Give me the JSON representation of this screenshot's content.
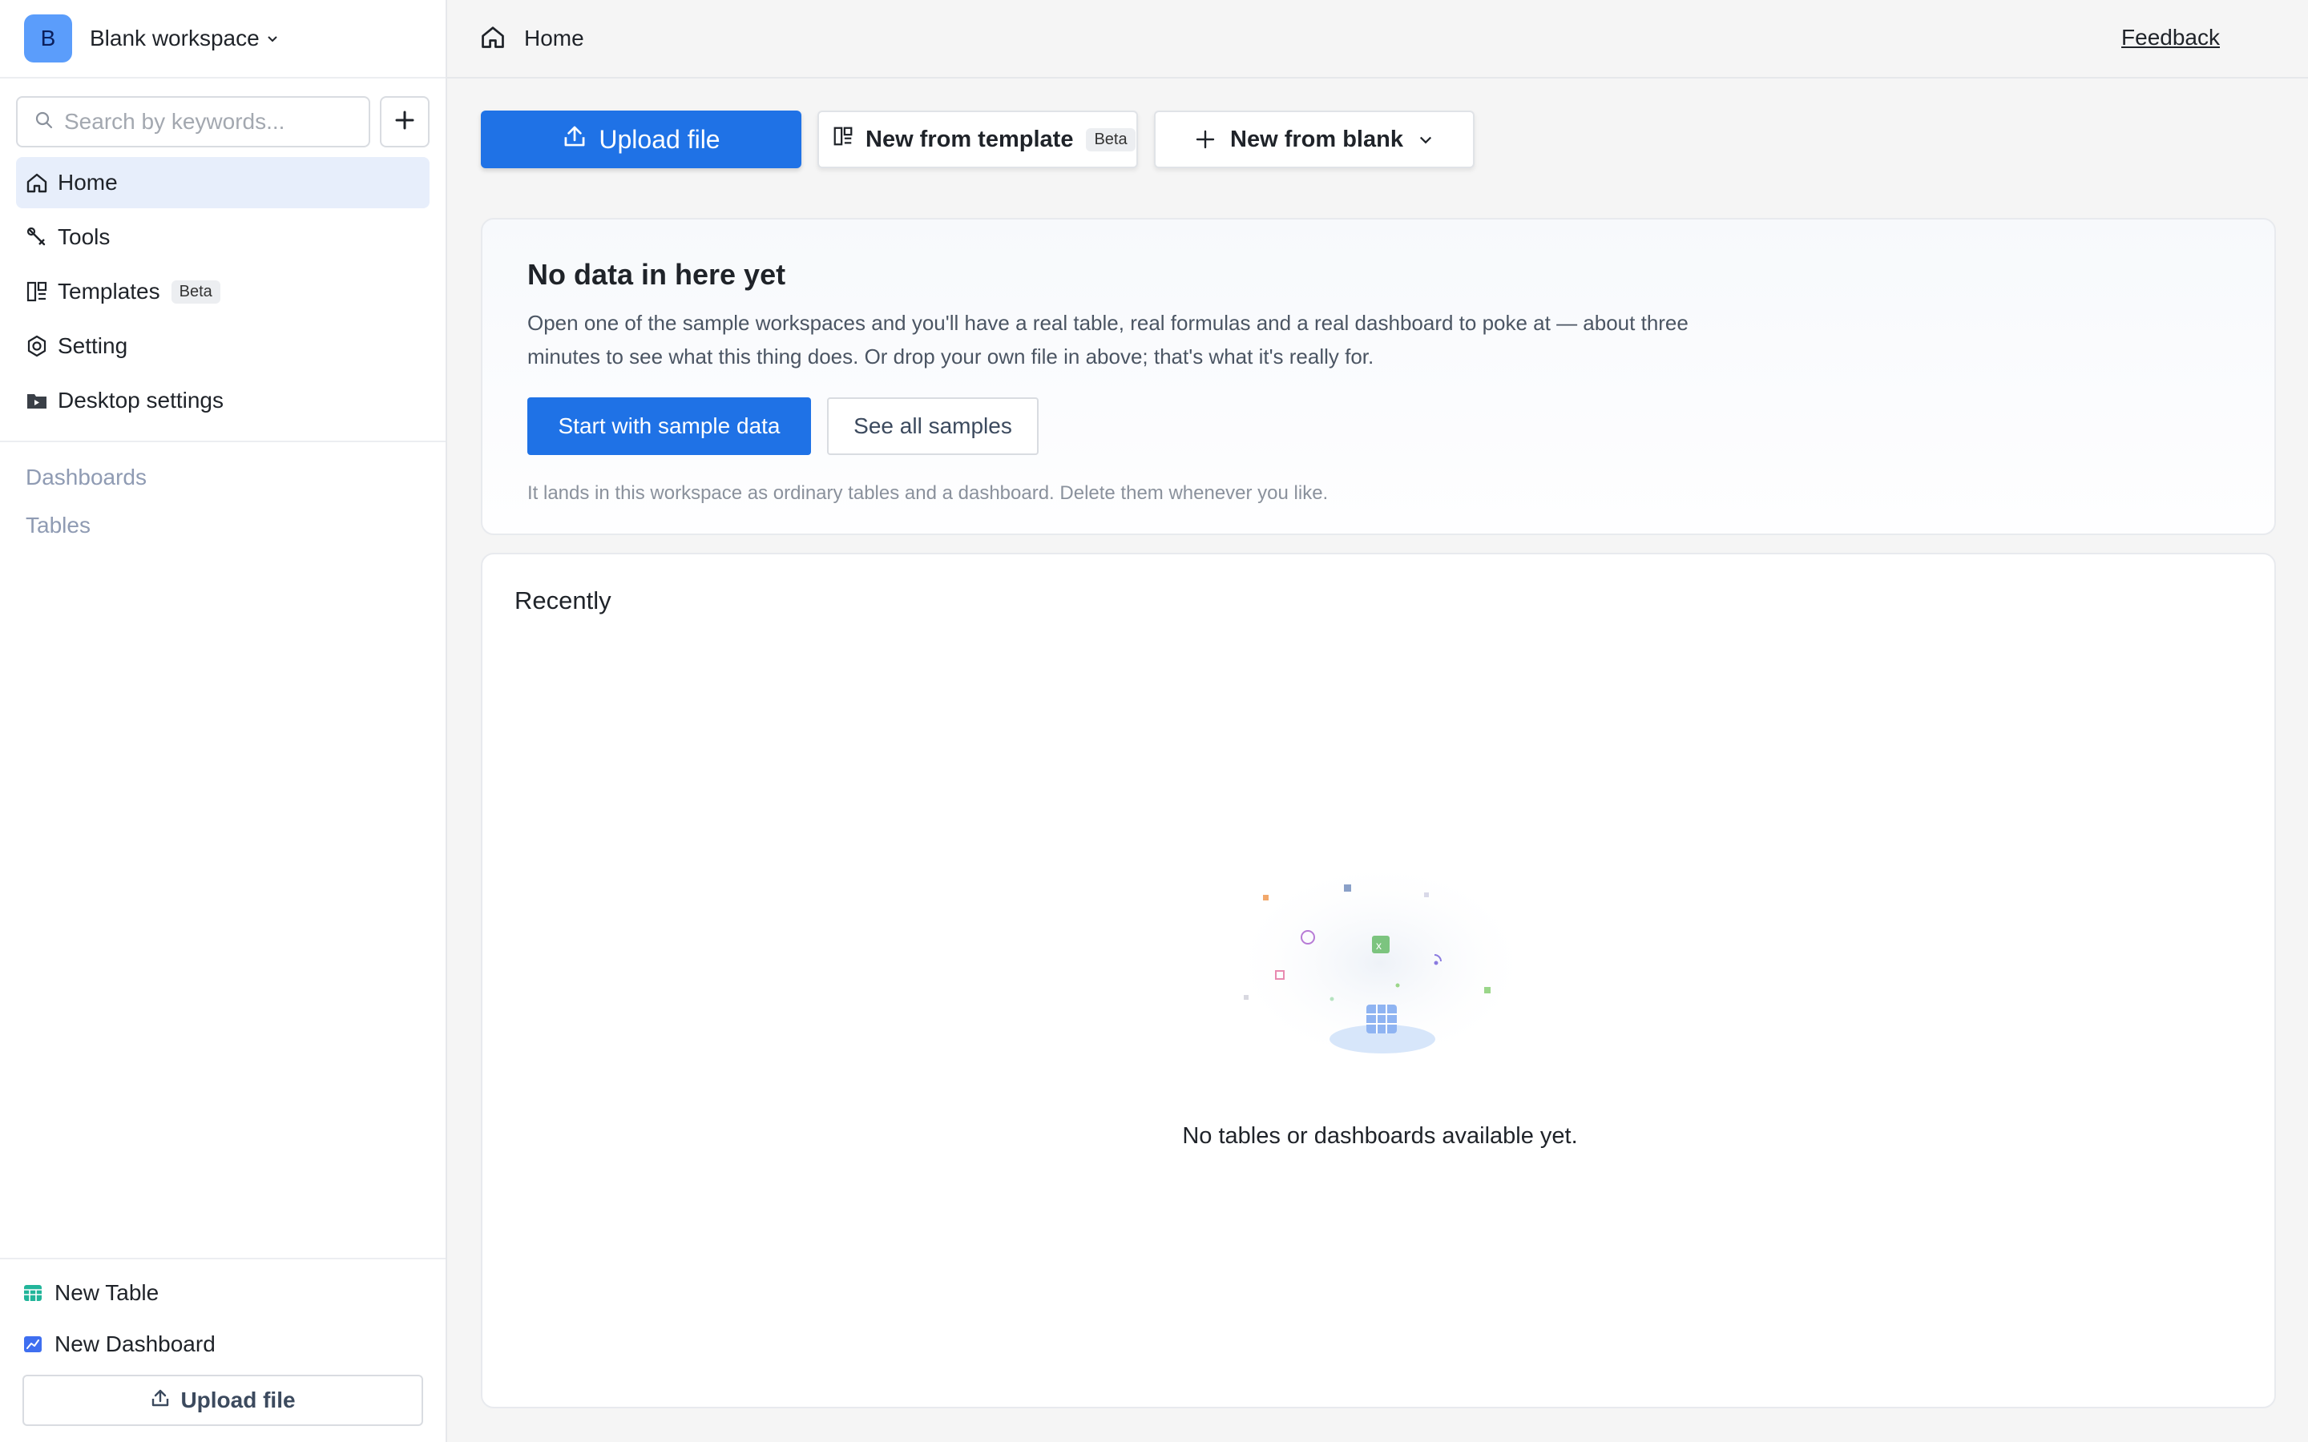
{
  "workspace": {
    "avatar_letter": "B",
    "name": "Blank workspace"
  },
  "search": {
    "placeholder": "Search by keywords..."
  },
  "sidebar": {
    "items": [
      {
        "label": "Home",
        "icon": "home-icon",
        "active": true
      },
      {
        "label": "Tools",
        "icon": "tools-icon"
      },
      {
        "label": "Templates",
        "icon": "templates-icon",
        "badge": "Beta"
      },
      {
        "label": "Setting",
        "icon": "gear-icon"
      },
      {
        "label": "Desktop settings",
        "icon": "desktop-settings-icon"
      }
    ],
    "sections": [
      "Dashboards",
      "Tables"
    ],
    "bottom": {
      "new_table": "New Table",
      "new_dashboard": "New Dashboard",
      "upload": "Upload file"
    }
  },
  "header": {
    "title": "Home",
    "feedback": "Feedback"
  },
  "actions": {
    "upload": "Upload file",
    "template": "New from template",
    "template_badge": "Beta",
    "blank": "New from blank"
  },
  "empty_card": {
    "title": "No data in here yet",
    "description": "Open one of the sample workspaces and you'll have a real table, real formulas and a real dashboard to poke at — about three minutes to see what this thing does. Or drop your own file in above; that's what it's really for.",
    "primary": "Start with sample data",
    "secondary": "See all samples",
    "note": "It lands in this workspace as ordinary tables and a dashboard. Delete them whenever you like."
  },
  "recent": {
    "title": "Recently",
    "empty_text": "No tables or dashboards available yet."
  },
  "colors": {
    "accent": "#1f72e6",
    "avatar": "#5b9dfb",
    "active_nav": "#e7eefb",
    "section_text": "#8f9bb3"
  }
}
